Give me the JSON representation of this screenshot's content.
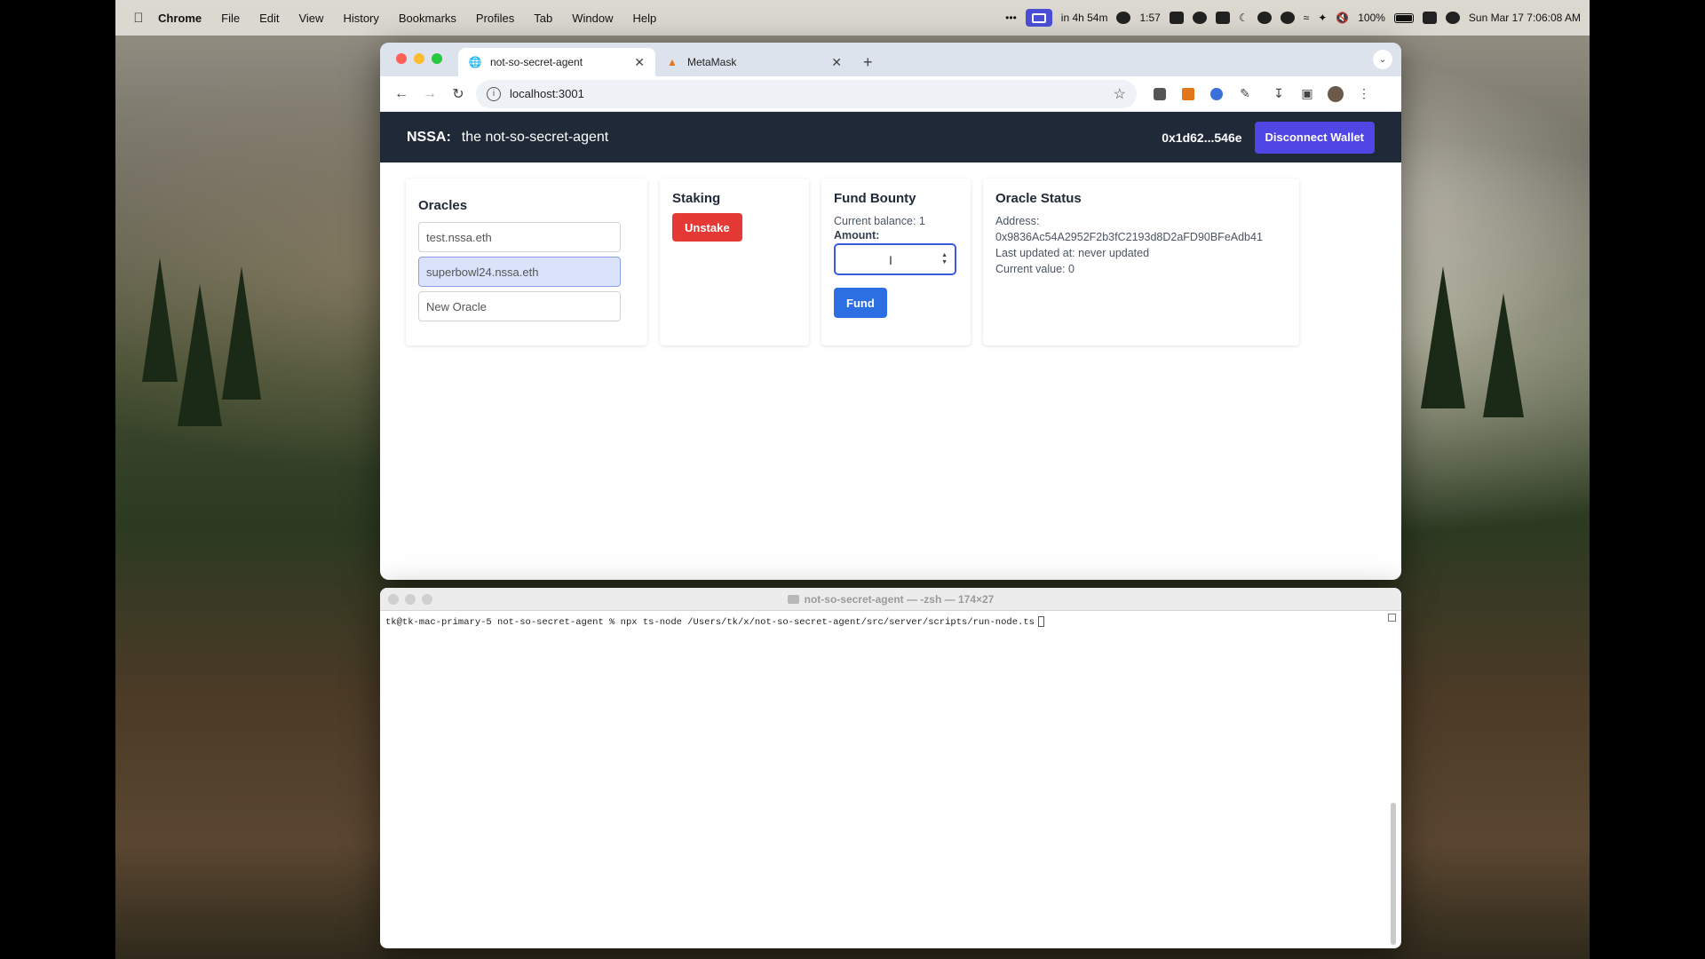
{
  "menubar": {
    "app_name": "Chrome",
    "items": [
      "File",
      "Edit",
      "View",
      "History",
      "Bookmarks",
      "Profiles",
      "Tab",
      "Window",
      "Help"
    ],
    "timer": "in 4h 54m",
    "record_time": "1:57",
    "battery": "100%",
    "datetime": "Sun Mar 17  7:06:08 AM"
  },
  "browser": {
    "tabs": [
      {
        "title": "not-so-secret-agent",
        "active": true
      },
      {
        "title": "MetaMask",
        "active": false
      }
    ],
    "url": "localhost:3001"
  },
  "app": {
    "brand": "NSSA:",
    "tagline": "the not-so-secret-agent",
    "wallet_address": "0x1d62...546e",
    "disconnect_label": "Disconnect Wallet",
    "oracles": {
      "title": "Oracles",
      "items": [
        "test.nssa.eth",
        "superbowl24.nssa.eth"
      ],
      "new_placeholder": "New Oracle"
    },
    "staking": {
      "title": "Staking",
      "unstake_label": "Unstake"
    },
    "fund": {
      "title": "Fund Bounty",
      "balance": "Current balance: 1",
      "amount_label": "Amount:",
      "amount_value": "",
      "fund_label": "Fund"
    },
    "status": {
      "title": "Oracle Status",
      "address_label": "Address:",
      "address": "0x9836Ac54A2952F2b3fC2193d8D2aFD90BFeAdb41",
      "updated": "Last updated at: never updated",
      "value": "Current value: 0"
    }
  },
  "terminal": {
    "title": "not-so-secret-agent — -zsh — 174×27",
    "line": "tk@tk-mac-primary-5 not-so-secret-agent % npx ts-node /Users/tk/x/not-so-secret-agent/src/server/scripts/run-node.ts"
  },
  "colors": {
    "nav_bg": "#1f2937",
    "disconnect": "#4f46e5",
    "unstake": "#e53935",
    "fund": "#2b6fe3"
  }
}
